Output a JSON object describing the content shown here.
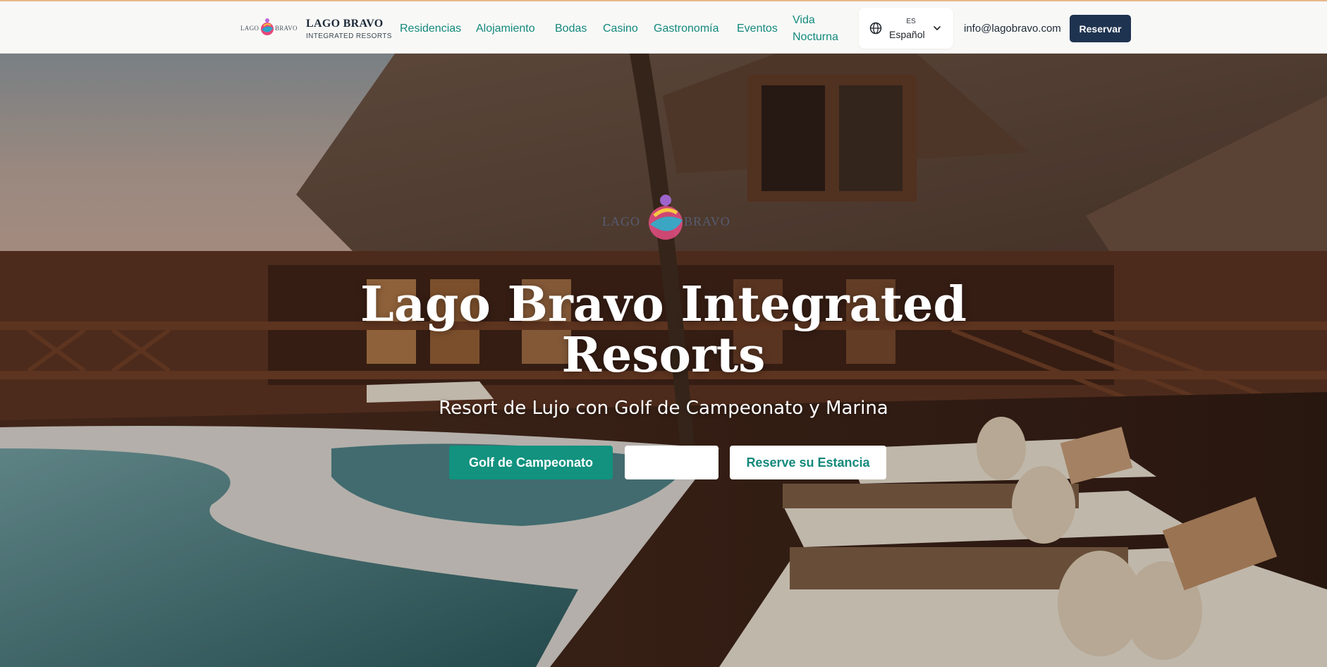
{
  "header": {
    "logo": {
      "left_word": "LAGO",
      "right_word": "BRAVO"
    },
    "brand_name": "LAGO BRAVO",
    "brand_sub": "INTEGRATED RESORTS",
    "nav": [
      {
        "label": "Residencias"
      },
      {
        "label": "Alojamiento"
      },
      {
        "label": "Bodas"
      },
      {
        "label": "Casino"
      },
      {
        "label": "Gastronomía"
      },
      {
        "label": "Eventos"
      },
      {
        "label_line1": "Vida",
        "label_line2": "Nocturna"
      }
    ],
    "language": {
      "code": "ES",
      "name": "Español",
      "icon": "globe-icon",
      "chevron": "chevron-down-icon"
    },
    "email": "info@lagobravo.com",
    "reserve_label": "Reservar"
  },
  "hero": {
    "logo": {
      "left_word": "LAGO",
      "right_word": "BRAVO"
    },
    "title_line1": "Lago Bravo Integrated",
    "title_line2": "Resorts",
    "subtitle": "Resort de Lujo con Golf de Campeonato y Marina",
    "buttons": {
      "golf": "Golf de Campeonato",
      "blank": "",
      "reserve": "Reserve su Estancia"
    }
  },
  "colors": {
    "accent": "#14897c",
    "primary_button": "#12927f",
    "navy": "#1e3350",
    "header_bg": "#f8f8f7"
  }
}
